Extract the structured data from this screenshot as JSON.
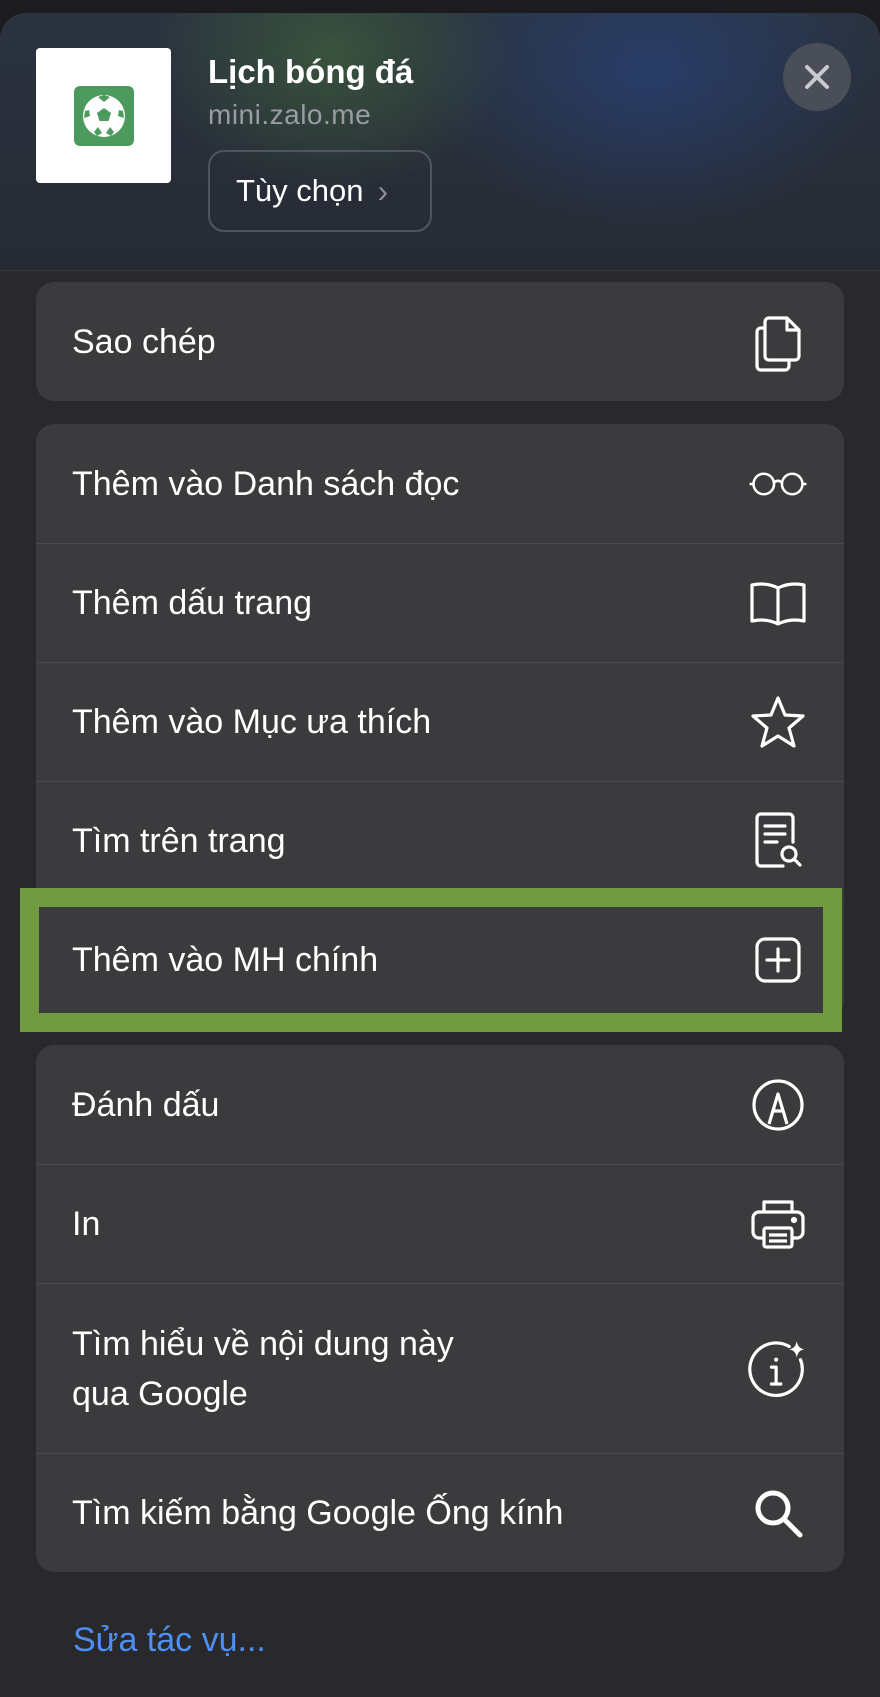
{
  "header": {
    "app_title": "Lịch bóng đá",
    "app_domain": "mini.zalo.me",
    "options_label": "Tùy chọn",
    "icon": "soccer-ball-icon",
    "accent": "#4c9a5e"
  },
  "groups": [
    {
      "items": [
        {
          "label": "Sao chép",
          "icon": "copy-icon"
        }
      ]
    },
    {
      "items": [
        {
          "label": "Thêm vào Danh sách đọc",
          "icon": "glasses-icon"
        },
        {
          "label": "Thêm dấu trang",
          "icon": "book-icon"
        },
        {
          "label": "Thêm vào Mục ưa thích",
          "icon": "star-icon"
        },
        {
          "label": "Tìm trên trang",
          "icon": "find-in-page-icon"
        },
        {
          "label": "Thêm vào MH chính",
          "icon": "add-square-icon",
          "highlighted": true
        }
      ]
    },
    {
      "items": [
        {
          "label": "Đánh dấu",
          "icon": "markup-icon"
        },
        {
          "label": "In",
          "icon": "printer-icon"
        },
        {
          "label": "Tìm hiểu về nội dung này\nqua Google",
          "icon": "info-sparkle-icon"
        },
        {
          "label": "Tìm kiếm bằng Google Ống kính",
          "icon": "search-icon"
        }
      ]
    }
  ],
  "footer": {
    "edit_actions": "Sửa tác vụ..."
  },
  "colors": {
    "highlight": "#6f9a3f",
    "link": "#4d8ff5"
  }
}
